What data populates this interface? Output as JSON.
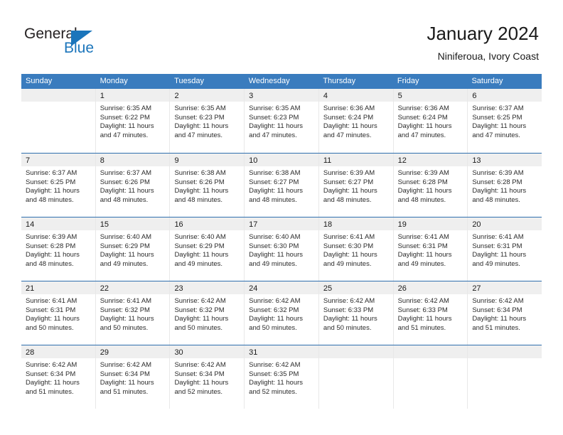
{
  "brand": {
    "name_part1": "General",
    "name_part2": "Blue"
  },
  "header": {
    "title": "January 2024",
    "subtitle": "Niniferoua, Ivory Coast"
  },
  "calendar": {
    "day_headers": [
      "Sunday",
      "Monday",
      "Tuesday",
      "Wednesday",
      "Thursday",
      "Friday",
      "Saturday"
    ],
    "accent_color": "#3a7cbe",
    "row_divider_color": "#2f6fae",
    "daynum_band_color": "#efefef",
    "weeks": [
      [
        {
          "day": ""
        },
        {
          "day": "1",
          "sunrise": "Sunrise: 6:35 AM",
          "sunset": "Sunset: 6:22 PM",
          "daylight1": "Daylight: 11 hours",
          "daylight2": "and 47 minutes."
        },
        {
          "day": "2",
          "sunrise": "Sunrise: 6:35 AM",
          "sunset": "Sunset: 6:23 PM",
          "daylight1": "Daylight: 11 hours",
          "daylight2": "and 47 minutes."
        },
        {
          "day": "3",
          "sunrise": "Sunrise: 6:35 AM",
          "sunset": "Sunset: 6:23 PM",
          "daylight1": "Daylight: 11 hours",
          "daylight2": "and 47 minutes."
        },
        {
          "day": "4",
          "sunrise": "Sunrise: 6:36 AM",
          "sunset": "Sunset: 6:24 PM",
          "daylight1": "Daylight: 11 hours",
          "daylight2": "and 47 minutes."
        },
        {
          "day": "5",
          "sunrise": "Sunrise: 6:36 AM",
          "sunset": "Sunset: 6:24 PM",
          "daylight1": "Daylight: 11 hours",
          "daylight2": "and 47 minutes."
        },
        {
          "day": "6",
          "sunrise": "Sunrise: 6:37 AM",
          "sunset": "Sunset: 6:25 PM",
          "daylight1": "Daylight: 11 hours",
          "daylight2": "and 47 minutes."
        }
      ],
      [
        {
          "day": "7",
          "sunrise": "Sunrise: 6:37 AM",
          "sunset": "Sunset: 6:25 PM",
          "daylight1": "Daylight: 11 hours",
          "daylight2": "and 48 minutes."
        },
        {
          "day": "8",
          "sunrise": "Sunrise: 6:37 AM",
          "sunset": "Sunset: 6:26 PM",
          "daylight1": "Daylight: 11 hours",
          "daylight2": "and 48 minutes."
        },
        {
          "day": "9",
          "sunrise": "Sunrise: 6:38 AM",
          "sunset": "Sunset: 6:26 PM",
          "daylight1": "Daylight: 11 hours",
          "daylight2": "and 48 minutes."
        },
        {
          "day": "10",
          "sunrise": "Sunrise: 6:38 AM",
          "sunset": "Sunset: 6:27 PM",
          "daylight1": "Daylight: 11 hours",
          "daylight2": "and 48 minutes."
        },
        {
          "day": "11",
          "sunrise": "Sunrise: 6:39 AM",
          "sunset": "Sunset: 6:27 PM",
          "daylight1": "Daylight: 11 hours",
          "daylight2": "and 48 minutes."
        },
        {
          "day": "12",
          "sunrise": "Sunrise: 6:39 AM",
          "sunset": "Sunset: 6:28 PM",
          "daylight1": "Daylight: 11 hours",
          "daylight2": "and 48 minutes."
        },
        {
          "day": "13",
          "sunrise": "Sunrise: 6:39 AM",
          "sunset": "Sunset: 6:28 PM",
          "daylight1": "Daylight: 11 hours",
          "daylight2": "and 48 minutes."
        }
      ],
      [
        {
          "day": "14",
          "sunrise": "Sunrise: 6:39 AM",
          "sunset": "Sunset: 6:28 PM",
          "daylight1": "Daylight: 11 hours",
          "daylight2": "and 48 minutes."
        },
        {
          "day": "15",
          "sunrise": "Sunrise: 6:40 AM",
          "sunset": "Sunset: 6:29 PM",
          "daylight1": "Daylight: 11 hours",
          "daylight2": "and 49 minutes."
        },
        {
          "day": "16",
          "sunrise": "Sunrise: 6:40 AM",
          "sunset": "Sunset: 6:29 PM",
          "daylight1": "Daylight: 11 hours",
          "daylight2": "and 49 minutes."
        },
        {
          "day": "17",
          "sunrise": "Sunrise: 6:40 AM",
          "sunset": "Sunset: 6:30 PM",
          "daylight1": "Daylight: 11 hours",
          "daylight2": "and 49 minutes."
        },
        {
          "day": "18",
          "sunrise": "Sunrise: 6:41 AM",
          "sunset": "Sunset: 6:30 PM",
          "daylight1": "Daylight: 11 hours",
          "daylight2": "and 49 minutes."
        },
        {
          "day": "19",
          "sunrise": "Sunrise: 6:41 AM",
          "sunset": "Sunset: 6:31 PM",
          "daylight1": "Daylight: 11 hours",
          "daylight2": "and 49 minutes."
        },
        {
          "day": "20",
          "sunrise": "Sunrise: 6:41 AM",
          "sunset": "Sunset: 6:31 PM",
          "daylight1": "Daylight: 11 hours",
          "daylight2": "and 49 minutes."
        }
      ],
      [
        {
          "day": "21",
          "sunrise": "Sunrise: 6:41 AM",
          "sunset": "Sunset: 6:31 PM",
          "daylight1": "Daylight: 11 hours",
          "daylight2": "and 50 minutes."
        },
        {
          "day": "22",
          "sunrise": "Sunrise: 6:41 AM",
          "sunset": "Sunset: 6:32 PM",
          "daylight1": "Daylight: 11 hours",
          "daylight2": "and 50 minutes."
        },
        {
          "day": "23",
          "sunrise": "Sunrise: 6:42 AM",
          "sunset": "Sunset: 6:32 PM",
          "daylight1": "Daylight: 11 hours",
          "daylight2": "and 50 minutes."
        },
        {
          "day": "24",
          "sunrise": "Sunrise: 6:42 AM",
          "sunset": "Sunset: 6:32 PM",
          "daylight1": "Daylight: 11 hours",
          "daylight2": "and 50 minutes."
        },
        {
          "day": "25",
          "sunrise": "Sunrise: 6:42 AM",
          "sunset": "Sunset: 6:33 PM",
          "daylight1": "Daylight: 11 hours",
          "daylight2": "and 50 minutes."
        },
        {
          "day": "26",
          "sunrise": "Sunrise: 6:42 AM",
          "sunset": "Sunset: 6:33 PM",
          "daylight1": "Daylight: 11 hours",
          "daylight2": "and 51 minutes."
        },
        {
          "day": "27",
          "sunrise": "Sunrise: 6:42 AM",
          "sunset": "Sunset: 6:34 PM",
          "daylight1": "Daylight: 11 hours",
          "daylight2": "and 51 minutes."
        }
      ],
      [
        {
          "day": "28",
          "sunrise": "Sunrise: 6:42 AM",
          "sunset": "Sunset: 6:34 PM",
          "daylight1": "Daylight: 11 hours",
          "daylight2": "and 51 minutes."
        },
        {
          "day": "29",
          "sunrise": "Sunrise: 6:42 AM",
          "sunset": "Sunset: 6:34 PM",
          "daylight1": "Daylight: 11 hours",
          "daylight2": "and 51 minutes."
        },
        {
          "day": "30",
          "sunrise": "Sunrise: 6:42 AM",
          "sunset": "Sunset: 6:34 PM",
          "daylight1": "Daylight: 11 hours",
          "daylight2": "and 52 minutes."
        },
        {
          "day": "31",
          "sunrise": "Sunrise: 6:42 AM",
          "sunset": "Sunset: 6:35 PM",
          "daylight1": "Daylight: 11 hours",
          "daylight2": "and 52 minutes."
        },
        {
          "day": ""
        },
        {
          "day": ""
        },
        {
          "day": ""
        }
      ]
    ]
  }
}
